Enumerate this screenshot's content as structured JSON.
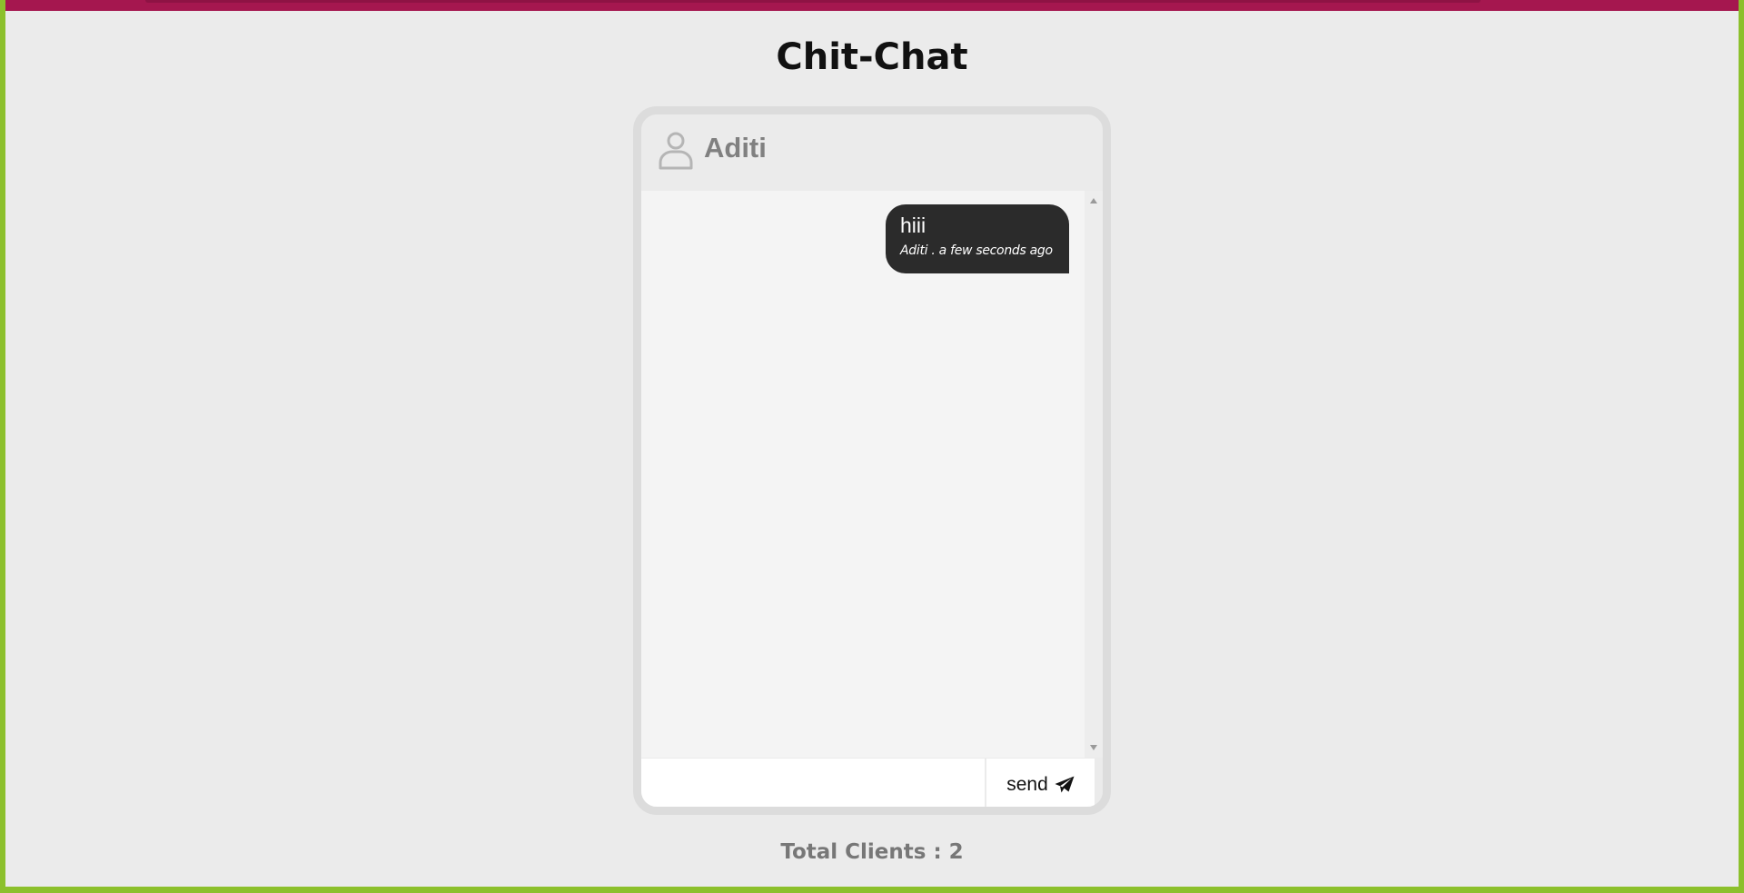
{
  "page": {
    "title": "Chit-Chat"
  },
  "chat": {
    "user_name": "Aditi",
    "icon": "user-icon",
    "messages": [
      {
        "text": "hiii",
        "meta": "Aditi . a few seconds ago"
      }
    ],
    "input": {
      "value": "",
      "placeholder": ""
    },
    "send_label": "send",
    "send_icon": "paper-plane-icon"
  },
  "footer": {
    "total_clients": "Total Clients : 2"
  },
  "colors": {
    "background": "#ebebeb",
    "top_bar": "#a5174f",
    "frame": "#8cc02c",
    "bubble": "#2b2b2b",
    "card_border": "#dcdcdc"
  }
}
